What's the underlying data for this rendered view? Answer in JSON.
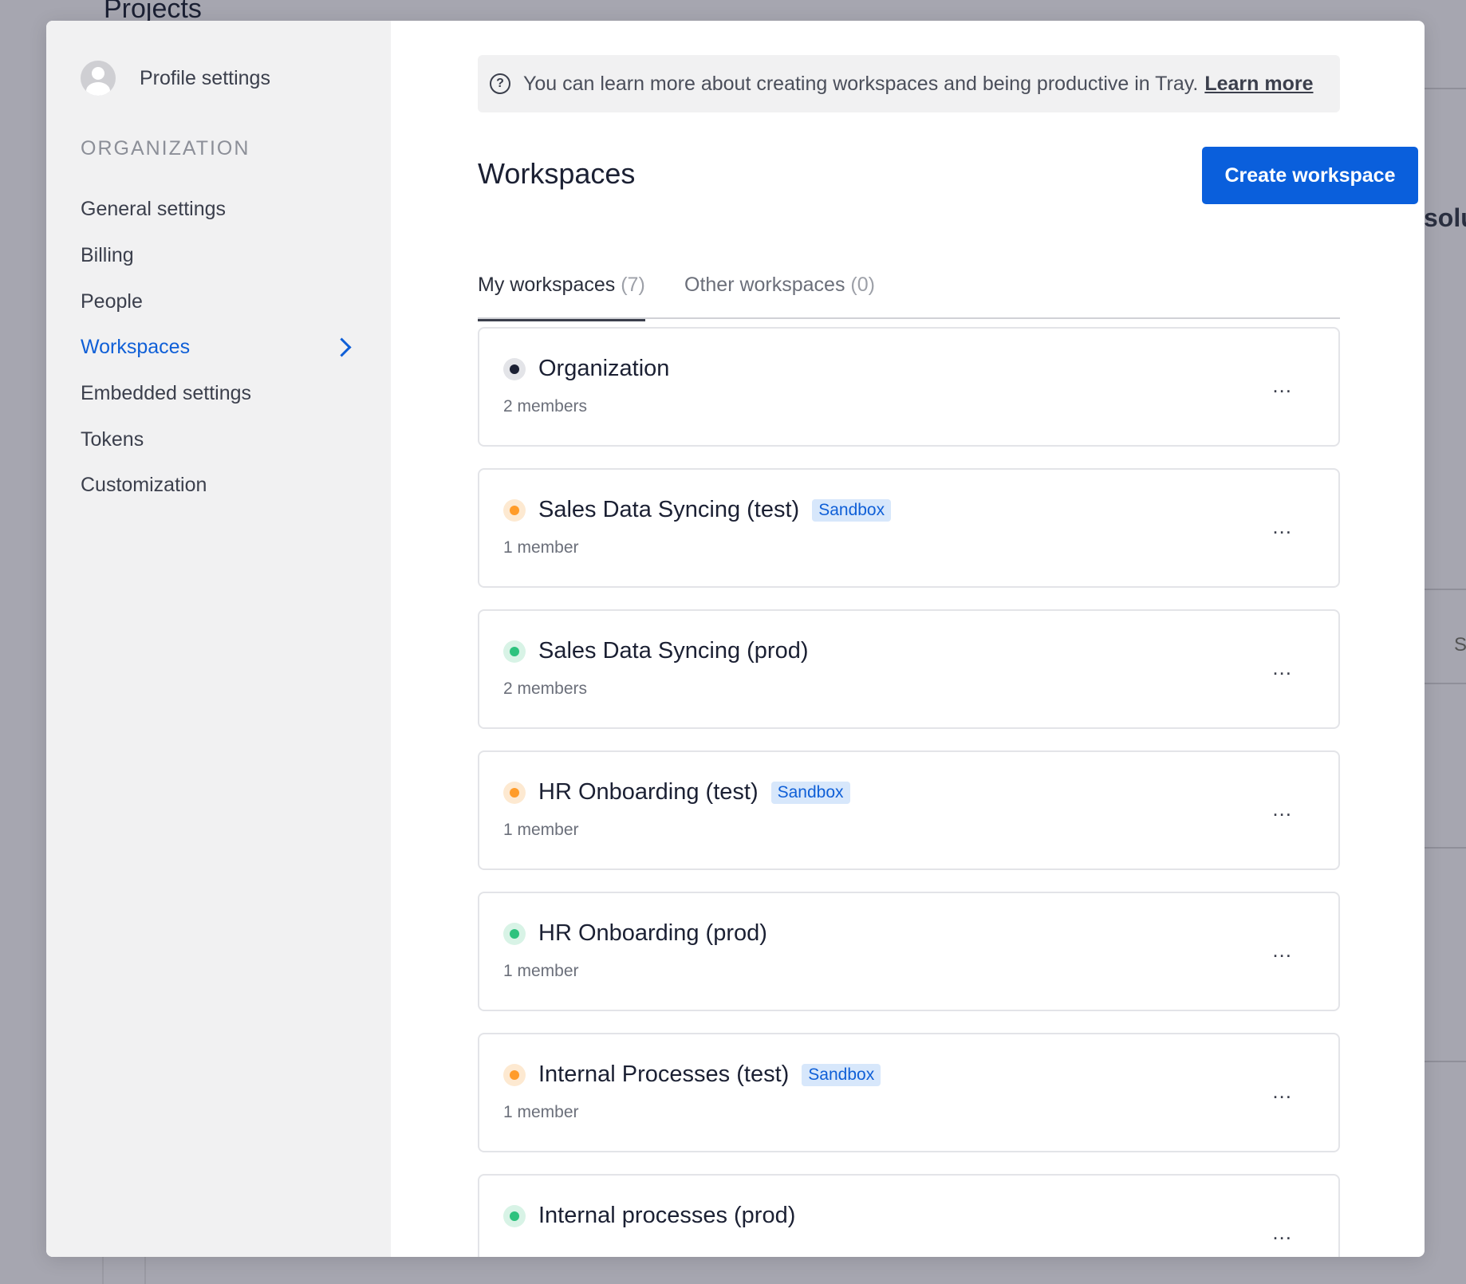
{
  "background": {
    "page_title": "Projects",
    "fragment_right": "solu",
    "fragment_s": "S"
  },
  "sidebar": {
    "profile_label": "Profile settings",
    "section_label": "ORGANIZATION",
    "items": [
      {
        "label": "General settings"
      },
      {
        "label": "Billing"
      },
      {
        "label": "People"
      },
      {
        "label": "Workspaces"
      },
      {
        "label": "Embedded settings"
      },
      {
        "label": "Tokens"
      },
      {
        "label": "Customization"
      }
    ]
  },
  "info": {
    "text": "You can learn more about creating workspaces and being productive in Tray.",
    "link": "Learn more"
  },
  "main": {
    "title": "Workspaces",
    "create_button": "Create workspace",
    "tabs": [
      {
        "label": "My workspaces",
        "count": "(7)"
      },
      {
        "label": "Other workspaces",
        "count": "(0)"
      }
    ]
  },
  "workspaces": [
    {
      "name": "Organization",
      "members": "2 members",
      "badge": "",
      "status_color": "#1b2033",
      "ring_color": "#e3e4e8"
    },
    {
      "name": "Sales Data Syncing (test)",
      "members": "1 member",
      "badge": "Sandbox",
      "status_color": "#ff9c2a",
      "ring_color": "#fde9d1"
    },
    {
      "name": "Sales Data Syncing (prod)",
      "members": "2 members",
      "badge": "",
      "status_color": "#2ec27e",
      "ring_color": "#d8f3e6"
    },
    {
      "name": "HR Onboarding (test)",
      "members": "1 member",
      "badge": "Sandbox",
      "status_color": "#ff9c2a",
      "ring_color": "#fde9d1"
    },
    {
      "name": "HR Onboarding (prod)",
      "members": "1 member",
      "badge": "",
      "status_color": "#2ec27e",
      "ring_color": "#d8f3e6"
    },
    {
      "name": "Internal Processes (test)",
      "members": "1 member",
      "badge": "Sandbox",
      "status_color": "#ff9c2a",
      "ring_color": "#fde9d1"
    },
    {
      "name": "Internal processes (prod)",
      "members": "",
      "badge": "",
      "status_color": "#2ec27e",
      "ring_color": "#d8f3e6"
    }
  ],
  "more_label": "..."
}
